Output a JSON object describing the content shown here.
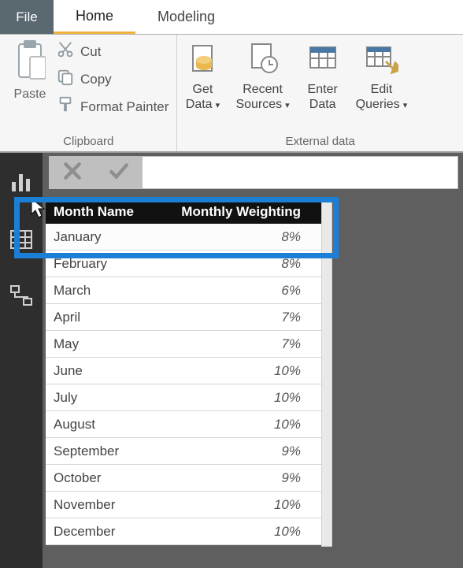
{
  "tabs": {
    "file": "File",
    "home": "Home",
    "modeling": "Modeling"
  },
  "ribbon": {
    "clipboard": {
      "group_label": "Clipboard",
      "paste": "Paste",
      "cut": "Cut",
      "copy": "Copy",
      "format_painter": "Format Painter"
    },
    "external": {
      "group_label": "External data",
      "get_data_l1": "Get",
      "get_data_l2": "Data",
      "recent_l1": "Recent",
      "recent_l2": "Sources",
      "enter_l1": "Enter",
      "enter_l2": "Data",
      "edit_l1": "Edit",
      "edit_l2": "Queries"
    }
  },
  "table": {
    "header_month": "Month Name",
    "header_weight": "Monthly Weighting",
    "rows": [
      {
        "month": "January",
        "weight": "8%"
      },
      {
        "month": "February",
        "weight": "8%"
      },
      {
        "month": "March",
        "weight": "6%"
      },
      {
        "month": "April",
        "weight": "7%"
      },
      {
        "month": "May",
        "weight": "7%"
      },
      {
        "month": "June",
        "weight": "10%"
      },
      {
        "month": "July",
        "weight": "10%"
      },
      {
        "month": "August",
        "weight": "10%"
      },
      {
        "month": "September",
        "weight": "9%"
      },
      {
        "month": "October",
        "weight": "9%"
      },
      {
        "month": "November",
        "weight": "10%"
      },
      {
        "month": "December",
        "weight": "10%"
      }
    ]
  },
  "chart_data": {
    "type": "table",
    "title": "Monthly Weighting",
    "columns": [
      "Month Name",
      "Monthly Weighting"
    ],
    "categories": [
      "January",
      "February",
      "March",
      "April",
      "May",
      "June",
      "July",
      "August",
      "September",
      "October",
      "November",
      "December"
    ],
    "values": [
      8,
      8,
      6,
      7,
      7,
      10,
      10,
      10,
      9,
      9,
      10,
      10
    ],
    "unit": "%"
  }
}
